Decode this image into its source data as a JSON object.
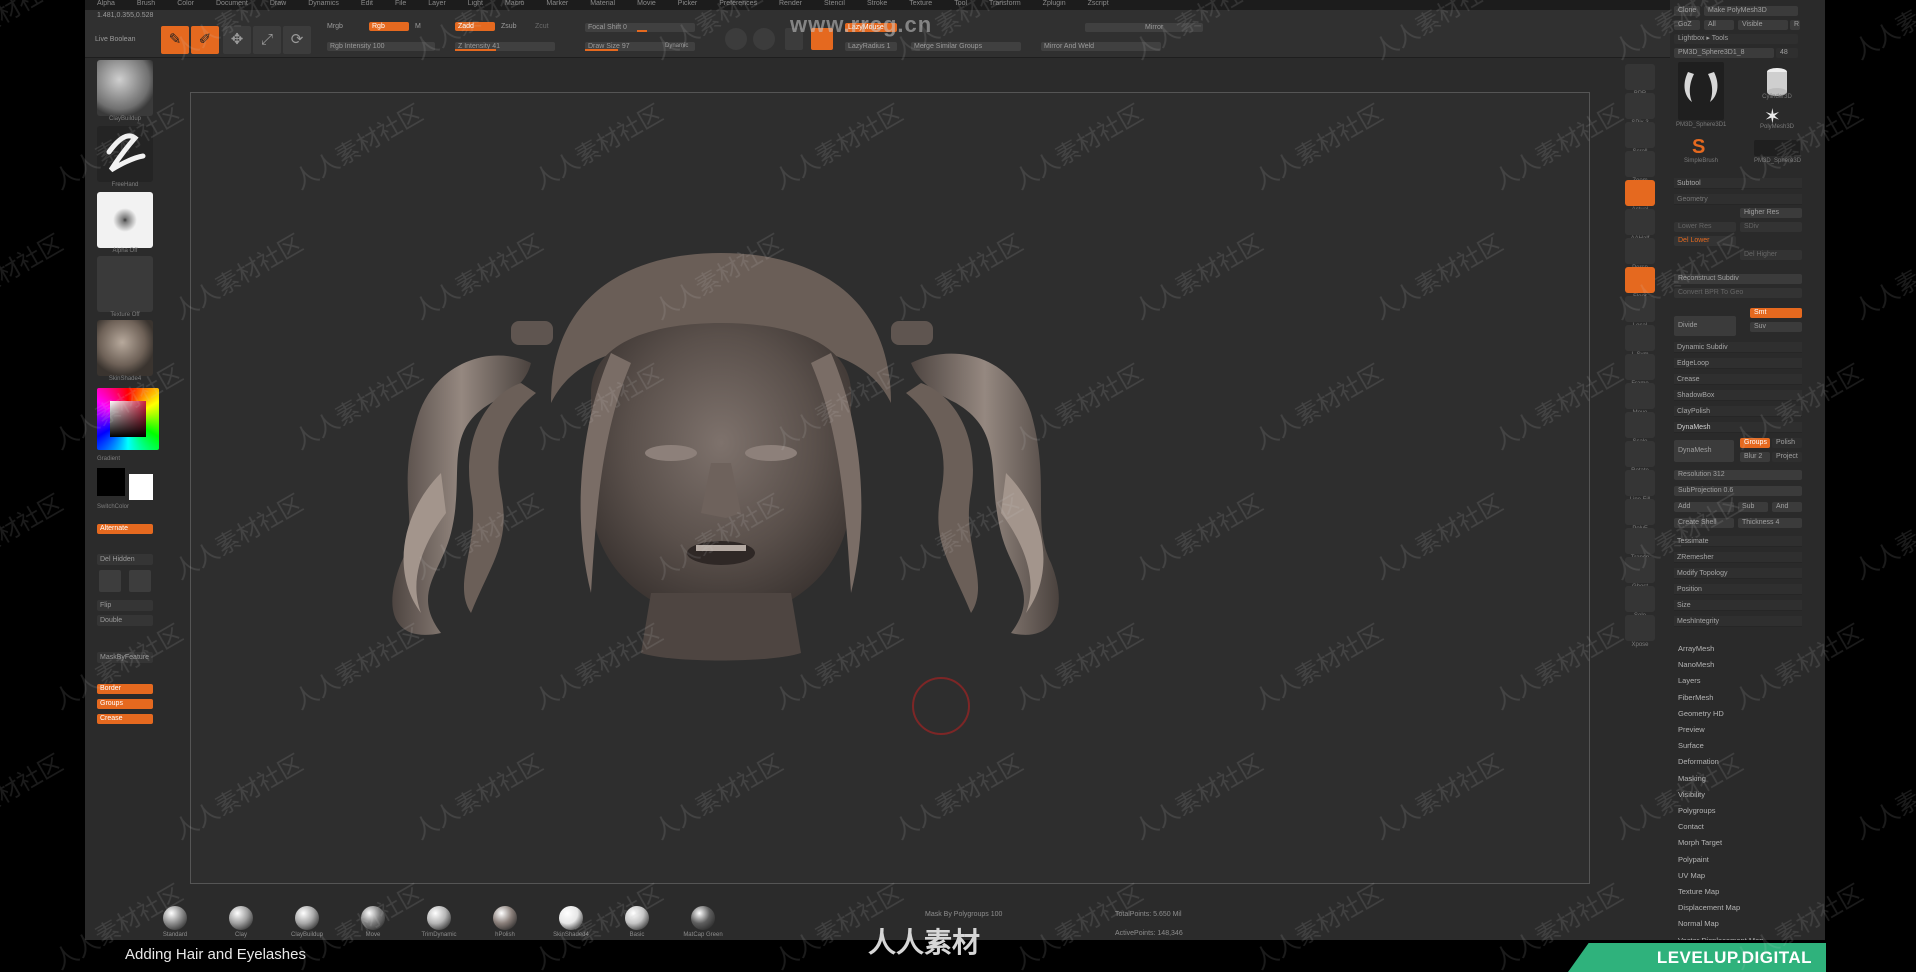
{
  "colors": {
    "accent": "#e5691f",
    "brand": "#2fb27c",
    "canvas_bg": "#2e2e2e",
    "ui_bg": "#2b2b2b"
  },
  "watermark": {
    "site": "www.rrcg.cn",
    "tile_text": "人人素材社区",
    "bottom_text": "人人素材"
  },
  "video": {
    "caption": "Adding Hair and Eyelashes",
    "brand": "LEVELUP.DIGITAL"
  },
  "menubar": {
    "items": [
      "Alpha",
      "Brush",
      "Color",
      "Document",
      "Draw",
      "Dynamics",
      "Edit",
      "File",
      "Layer",
      "Light",
      "Macro",
      "Marker",
      "Material",
      "Movie",
      "Picker",
      "Preferences",
      "Render",
      "Stencil",
      "Stroke",
      "Texture",
      "Tool",
      "Transform",
      "Zplugin",
      "Zscript"
    ]
  },
  "toolbar": {
    "coords": "1.481,0.355,0.528",
    "live_boolean": "Live Boolean",
    "edit_label": "Edit",
    "draw_label": "Draw",
    "move_label": "Move",
    "scale_label": "Scale",
    "rotate_label": "Rotate",
    "mrgb": "Mrgb",
    "rgb": "Rgb",
    "m": "M",
    "rgb_intensity": "Rgb Intensity 100",
    "zadd": "Zadd",
    "zsub": "Zsub",
    "zcut": "Zcut",
    "z_intensity": "Z Intensity 41",
    "focal_shift": "Focal Shift 0",
    "draw_size": "Draw Size 97",
    "dynamic": "Dynamic",
    "lazymouse": "LazyMouse",
    "lazyradius": "LazyRadius 1",
    "merge_similar": "Merge Similar Groups",
    "mirror": "Mirror",
    "mirror_weld": "Mirror And Weld"
  },
  "left_shelf": {
    "brush": "ClayBuildup",
    "stroke": "FreeHand",
    "alpha": "Alpha Off",
    "texture": "Texture Off",
    "material": "SkinShade4",
    "gradient": "Gradient",
    "switch_color": "SwitchColor",
    "alternate": "Alternate",
    "del_hidden": "Del Hidden",
    "flip": "Flip",
    "double": "Double",
    "mask_by_feature": "MaskByFeature",
    "border": "Border",
    "groups": "Groups",
    "crease": "Crease"
  },
  "materials": [
    "Standard",
    "Clay",
    "ClayBuildup",
    "Move",
    "TrimDynamic",
    "hPolish",
    "SkinShaded4",
    "Basic",
    "MatCap Green"
  ],
  "status": {
    "mask_by_polygroups": "Mask By Polygroups 100",
    "total_points": "TotalPoints: 5.650 Mil",
    "active_points": "ActivePoints: 148,346"
  },
  "right_dock": [
    "BPR",
    "SPix 3",
    "Scroll",
    "Zoom",
    "Actual",
    "AAHalf",
    "Persp",
    "Floor",
    "Local",
    "L.Sym",
    "Frame",
    "Move",
    "Scale",
    "Rotate",
    "Line Fill",
    "PolyF",
    "Transp",
    "Ghost",
    "Solo",
    "Xpose"
  ],
  "right_panel": {
    "clone": "Clone",
    "make_polymesh": "Make PolyMesh3D",
    "goz": "GoZ",
    "all": "All",
    "visible": "Visible",
    "r": "R",
    "lightbox_tools": "Lightbox ▸ Tools",
    "tool_name": "PM3D_Sphere3D1_8",
    "tool_count": "48",
    "tools": [
      "PM3D_Sphere3D1",
      "Cylinder3D",
      "PolyMesh3D",
      "SimpleBrush",
      "PM3D_Sphere3D"
    ],
    "subtool": "Subtool",
    "geometry": "Geometry",
    "higher_res": "Higher Res",
    "lower_res": "Lower Res",
    "sdiv": "SDiv",
    "del_lower": "Del Lower",
    "del_higher": "Del Higher",
    "reconstruct": "Reconstruct Subdiv",
    "convert_bpr": "Convert BPR To Geo",
    "divide": "Divide",
    "smt": "Smt",
    "suv": "Suv",
    "dynamic_subdiv": "Dynamic Subdiv",
    "edgeloop": "EdgeLoop",
    "crease": "Crease",
    "shadowbox": "ShadowBox",
    "claypolish": "ClayPolish",
    "dynamesh_header": "DynaMesh",
    "dynamesh": "DynaMesh",
    "groups": "Groups",
    "polish": "Polish",
    "blur": "Blur 2",
    "project": "Project",
    "resolution": "Resolution 312",
    "subprojection": "SubProjection 0.6",
    "add": "Add",
    "sub": "Sub",
    "and": "And",
    "create_shell": "Create Shell",
    "thickness": "Thickness 4",
    "tessimate": "Tessimate",
    "zremesher": "ZRemesher",
    "modify_topology": "Modify Topology",
    "position": "Position",
    "size": "Size",
    "mesh_integrity": "MeshIntegrity",
    "menu": [
      "ArrayMesh",
      "NanoMesh",
      "Layers",
      "FiberMesh",
      "Geometry HD",
      "Preview",
      "Surface",
      "Deformation",
      "Masking",
      "Visibility",
      "Polygroups",
      "Contact",
      "Morph Target",
      "Polypaint",
      "UV Map",
      "Texture Map",
      "Displacement Map",
      "Normal Map",
      "Vector Displacement Map"
    ]
  }
}
